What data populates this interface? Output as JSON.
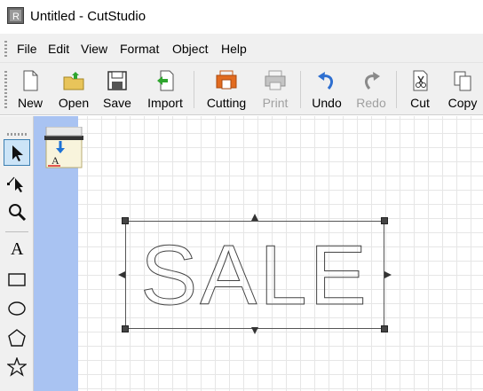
{
  "window": {
    "title": "Untitled - CutStudio"
  },
  "menu": [
    "File",
    "Edit",
    "View",
    "Format",
    "Object",
    "Help"
  ],
  "toolbar": {
    "buttons": [
      {
        "label": "New",
        "icon": "new-document-icon",
        "enabled": true
      },
      {
        "label": "Open",
        "icon": "open-folder-icon",
        "enabled": true
      },
      {
        "label": "Save",
        "icon": "save-disk-icon",
        "enabled": true
      },
      {
        "label": "Import",
        "icon": "import-icon",
        "enabled": true
      },
      {
        "label": "Cutting",
        "icon": "cutting-printer-icon",
        "enabled": true
      },
      {
        "label": "Print",
        "icon": "printer-icon",
        "enabled": false
      },
      {
        "label": "Undo",
        "icon": "undo-arrow-icon",
        "enabled": true
      },
      {
        "label": "Redo",
        "icon": "redo-arrow-icon",
        "enabled": false
      },
      {
        "label": "Cut",
        "icon": "scissors-icon",
        "enabled": true
      },
      {
        "label": "Copy",
        "icon": "copy-icon",
        "enabled": true
      }
    ]
  },
  "tools": [
    {
      "name": "select-arrow-icon",
      "active": true
    },
    {
      "name": "node-edit-icon",
      "active": false
    },
    {
      "name": "zoom-magnifier-icon",
      "active": false
    },
    {
      "name": "text-tool-icon",
      "active": false
    },
    {
      "name": "rectangle-tool-icon",
      "active": false
    },
    {
      "name": "ellipse-tool-icon",
      "active": false
    },
    {
      "name": "polygon-tool-icon",
      "active": false
    },
    {
      "name": "star-tool-icon",
      "active": false
    }
  ],
  "canvas": {
    "text_object": "SALE",
    "text_tool_glyph": "A",
    "accent_color": "#a9c3f2"
  }
}
